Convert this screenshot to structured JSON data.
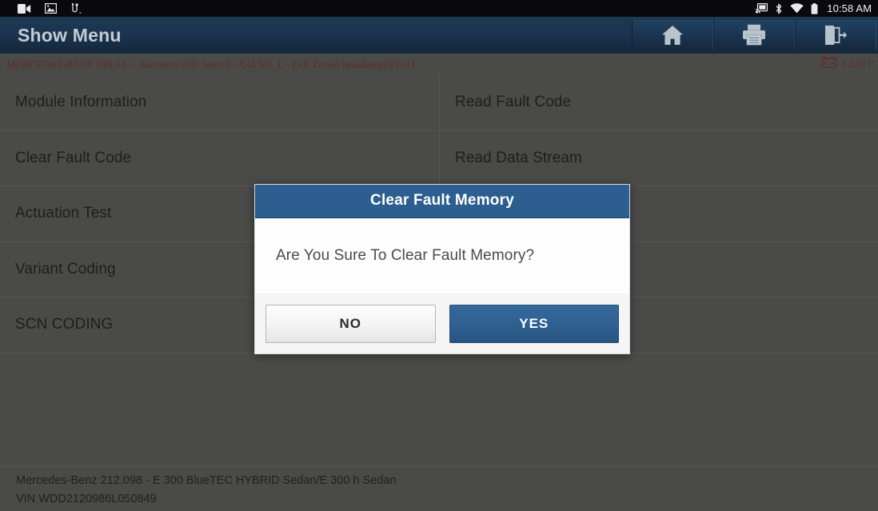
{
  "statusbar": {
    "left_icons": [
      "camcorder-icon",
      "photo-icon",
      "usb-icon"
    ],
    "right_icons": [
      "screen-cast-icon",
      "bluetooth-icon",
      "wifi-icon",
      "battery-icon"
    ],
    "time": "10:58 AM"
  },
  "titlebar": {
    "title": "Show Menu",
    "actions": [
      {
        "name": "home-button",
        "icon": "home-icon"
      },
      {
        "name": "print-button",
        "icon": "printer-icon"
      },
      {
        "name": "exit-button",
        "icon": "exit-icon"
      }
    ]
  },
  "breadcrumb": {
    "path": "MERCEDES-BENZ V49.54 > Automatically Search>XALWA_L - Left Xenon headlamp(E1n1)",
    "voltage": "12.51V",
    "voltage_icon": "car-battery-icon"
  },
  "menu": {
    "items": [
      "Module Information",
      "Read Fault Code",
      "Clear Fault Code",
      "Read Data Stream",
      "Actuation Test",
      "",
      "Variant Coding",
      "",
      "SCN CODING",
      ""
    ]
  },
  "dialog": {
    "title": "Clear Fault Memory",
    "message": "Are You Sure To Clear Fault Memory?",
    "no_label": "NO",
    "yes_label": "YES"
  },
  "footer": {
    "vehicle": "Mercedes-Benz 212.098 - E 300 BlueTEC HYBRID Sedan/E 300 h Sedan",
    "vin": "VIN WDD2120986L050849"
  },
  "colors": {
    "titlebar": "#1b3450",
    "accent_blue": "#2c5f8f",
    "breadcrumb_text": "#8c4234",
    "content_bg": "#6a6a67"
  }
}
